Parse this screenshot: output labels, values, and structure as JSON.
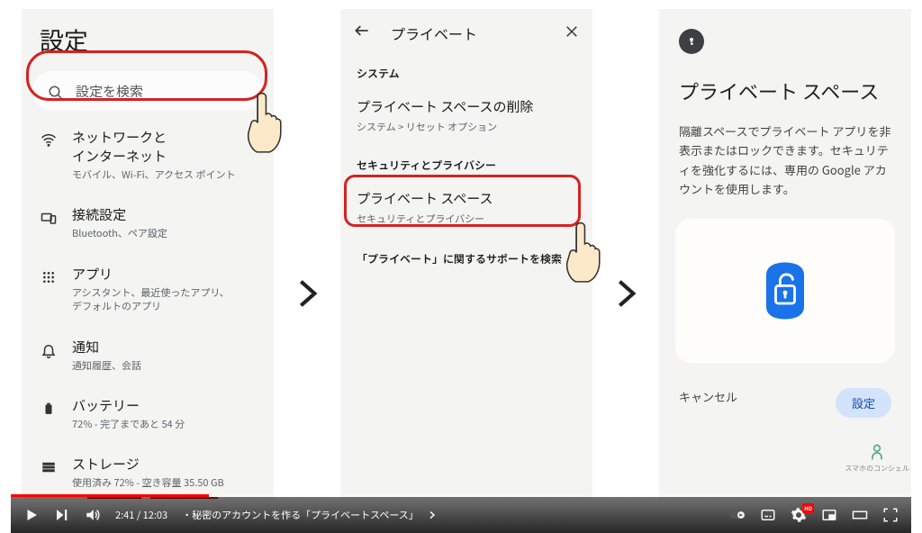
{
  "panel1": {
    "title": "設定",
    "search_placeholder": "設定を検索",
    "items": [
      {
        "title": "ネットワークと\nインターネット",
        "sub": "モバイル、Wi-Fi、アクセス ポイント"
      },
      {
        "title": "接続設定",
        "sub": "Bluetooth、ペア設定"
      },
      {
        "title": "アプリ",
        "sub": "アシスタント、最近使ったアプリ、\nデフォルトのアプリ"
      },
      {
        "title": "通知",
        "sub": "通知履歴、会話"
      },
      {
        "title": "バッテリー",
        "sub": "72% - 完了まであと 54 分"
      },
      {
        "title": "ストレージ",
        "sub": "使用済み 72% - 空き容量 35.50 GB"
      }
    ]
  },
  "panel2": {
    "header": "プライベート",
    "section_a": "システム",
    "item_a": {
      "title": "プライベート スペースの削除",
      "sub": "システム > リセット オプション"
    },
    "section_b": "セキュリティとプライバシー",
    "item_b": {
      "title": "プライベート スペース",
      "sub": "セキュリティとプライバシー"
    },
    "help": "「プライベート」に関するサポートを検索"
  },
  "panel3": {
    "title": "プライベート スペース",
    "body": "隔離スペースでプライベート アプリを非表示またはロックできます。セキュリティを強化するには、専用の Google アカウントを使用します。",
    "cancel": "キャンセル",
    "setup": "設定"
  },
  "video": {
    "time": "2:41 / 12:03",
    "chapter": "・秘密のアカウントを作る「プライベートスペース」",
    "hd": "HD"
  },
  "watermark": "スマホのコンシェル"
}
